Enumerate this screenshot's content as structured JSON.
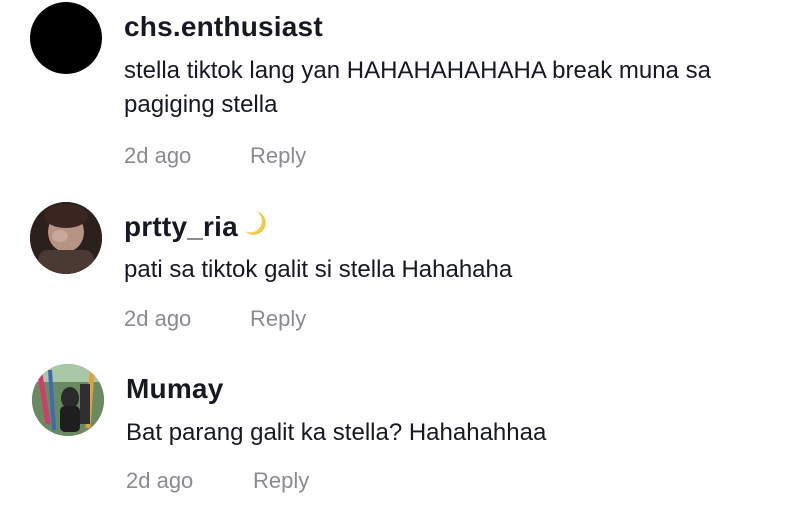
{
  "comments": [
    {
      "username": "chs.enthusiast",
      "text": "stella tiktok lang yan HAHAHAHAHAHA break muna sa pagiging stella",
      "time": "2d ago",
      "reply_label": "Reply",
      "avatar": "black-circle-avatar"
    },
    {
      "username": "prtty_ria",
      "username_emoji": "crescent-moon-icon",
      "text": "pati sa tiktok galit si stella Hahahaha",
      "time": "2d ago",
      "reply_label": "Reply",
      "avatar": "photo-avatar"
    },
    {
      "username": "Mumay",
      "text": "Bat parang galit ka stella? Hahahahhaa",
      "time": "2d ago",
      "reply_label": "Reply",
      "avatar": "photo-avatar"
    }
  ],
  "colors": {
    "username": "#161823",
    "text": "#161823",
    "meta": "#8a8b91",
    "moon": "#f6c945"
  }
}
